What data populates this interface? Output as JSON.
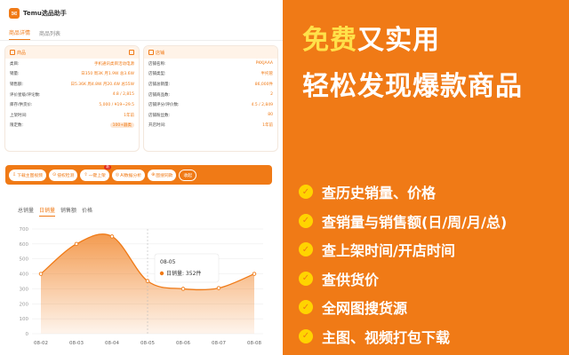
{
  "app": {
    "title": "Temu选品助手",
    "logo_glyph": "✉"
  },
  "tabs": [
    {
      "label": "商品详情"
    },
    {
      "label": "商品列表"
    }
  ],
  "product_card": {
    "title": "商品",
    "rows": [
      {
        "k": "类目:",
        "v": "手机通讯类目活动电源"
      },
      {
        "k": "销量:",
        "v": "日350 周3K 月1.9W 总3.6W"
      },
      {
        "k": "销售额:",
        "v": "日5.36K 周4.8W 月20.4W 总55W"
      },
      {
        "k": "评价星级/评论数:",
        "v": "4.8 / 2,815"
      },
      {
        "k": "库存/供货价:",
        "v": "5,000 / ¥19~29.5"
      },
      {
        "k": "上架时间:",
        "v": "1年前"
      },
      {
        "k": "限定数:",
        "v": "100+器类"
      }
    ]
  },
  "store_card": {
    "title": "店铺",
    "rows": [
      {
        "k": "店铺名称:",
        "v": "PKKJAAA"
      },
      {
        "k": "店铺类型:",
        "v": "半托管"
      },
      {
        "k": "店铺总销量:",
        "v": "86,000件"
      },
      {
        "k": "店铺商品数:",
        "v": "2"
      },
      {
        "k": "店铺评分/评价数:",
        "v": "4.5 / 2,849"
      },
      {
        "k": "店铺粉丝数:",
        "v": "80"
      },
      {
        "k": "开店时间:",
        "v": "1年前"
      }
    ]
  },
  "toolbar": {
    "buttons": [
      {
        "icon": "⇩",
        "label": "下载主图视频"
      },
      {
        "icon": "⊙",
        "label": "侵权检测"
      },
      {
        "icon": "⇧",
        "label": "一键上架",
        "badge": "新"
      },
      {
        "icon": "◎",
        "label": "AI数据分析"
      },
      {
        "icon": "⊕",
        "label": "图搜同款"
      }
    ],
    "collapse_label": "收起"
  },
  "chart_tabs": [
    {
      "label": "总销量"
    },
    {
      "label": "日销量"
    },
    {
      "label": "销售额"
    },
    {
      "label": "价格"
    }
  ],
  "chart_data": {
    "type": "area",
    "categories": [
      "08-02",
      "08-03",
      "08-04",
      "08-05",
      "08-06",
      "08-07",
      "08-08"
    ],
    "series": [
      {
        "values": [
          400,
          600,
          650,
          352,
          300,
          305,
          400
        ]
      }
    ],
    "ylim": [
      0,
      700
    ],
    "yticks": [
      0,
      100,
      200,
      300,
      400,
      500,
      600,
      700
    ],
    "tooltip": {
      "title": "08-05",
      "label": "日销量: 352件",
      "index": 3
    },
    "color": "#f07a16"
  },
  "headline": {
    "line1_hl": "免费",
    "line1_rest": "又实用",
    "line2": "轻松发现爆款商品"
  },
  "features": [
    {
      "label": "查历史销量、价格"
    },
    {
      "label": "查销量与销售额(日/周/月/总)"
    },
    {
      "label": "查上架时间/开店时间"
    },
    {
      "label": "查供货价"
    },
    {
      "label": "全网图搜货源"
    },
    {
      "label": "主图、视频打包下载"
    }
  ],
  "check_glyph": "✓"
}
